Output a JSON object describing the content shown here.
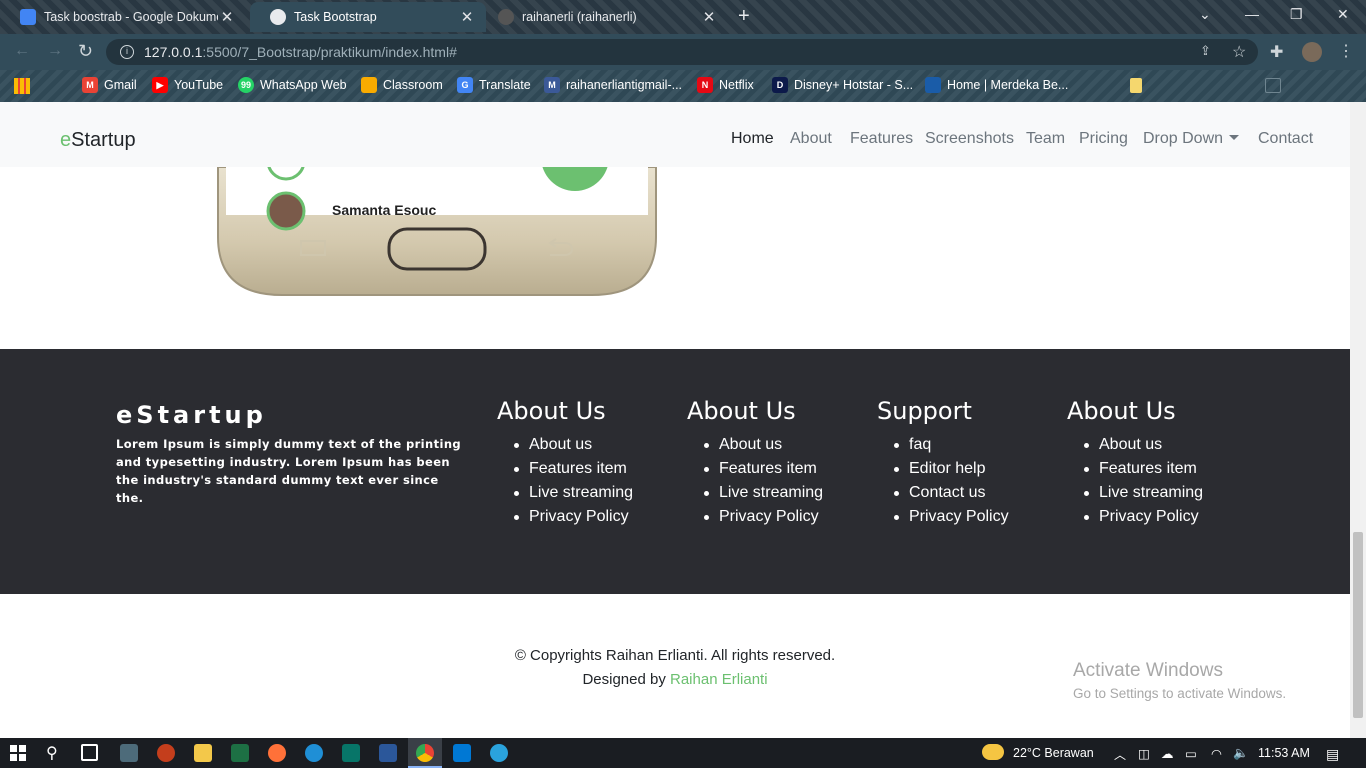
{
  "browser": {
    "tabs": [
      {
        "title": "Task boostrab - Google Dokumen",
        "icon": "google-docs-icon",
        "color": "#4285f4"
      },
      {
        "title": "Task Bootstrap",
        "icon": "globe-icon",
        "color": "#e8eaed"
      },
      {
        "title": "raihanerli (raihanerli)",
        "icon": "github-icon",
        "color": "#cccccc"
      }
    ],
    "url_host": "127.0.0.1",
    "url_path": ":5500/7_Bootstrap/praktikum/index.html#",
    "bookmarks": [
      {
        "label": "Gmail",
        "icon": "gmail-icon",
        "color": "#ea4335"
      },
      {
        "label": "YouTube",
        "icon": "youtube-icon",
        "color": "#ff0000"
      },
      {
        "label": "WhatsApp Web",
        "icon": "whatsapp-icon",
        "color": "#25d366"
      },
      {
        "label": "Classroom",
        "icon": "classroom-icon",
        "color": "#f9ab00"
      },
      {
        "label": "Translate",
        "icon": "translate-icon",
        "color": "#4285f4"
      },
      {
        "label": "raihanerliantigmail-...",
        "icon": "medium-icon",
        "color": "#3b5998"
      },
      {
        "label": "Netflix",
        "icon": "netflix-icon",
        "color": "#e50914"
      },
      {
        "label": "Disney+ Hotstar - S...",
        "icon": "hotstar-icon",
        "color": "#0c1a4a"
      },
      {
        "label": "Home | Merdeka Be...",
        "icon": "merdeka-icon",
        "color": "#1a5ca8"
      }
    ]
  },
  "site": {
    "brand_first": "e",
    "brand_rest": "Startup",
    "nav": [
      "Home",
      "About",
      "Features",
      "Screenshots",
      "Team",
      "Pricing",
      "Drop Down",
      "Contact"
    ],
    "phone_contact": "Samanta Esouc"
  },
  "footer": {
    "brand": "eStartup",
    "description": "Lorem Ipsum is simply dummy text of the printing and typesetting industry. Lorem Ipsum has been the industry's standard dummy text ever since the.",
    "columns": [
      {
        "title": "About Us",
        "items": [
          "About us",
          "Features item",
          "Live streaming",
          "Privacy Policy"
        ]
      },
      {
        "title": "About Us",
        "items": [
          "About us",
          "Features item",
          "Live streaming",
          "Privacy Policy"
        ]
      },
      {
        "title": "Support",
        "items": [
          "faq",
          "Editor help",
          "Contact us",
          "Privacy Policy"
        ]
      },
      {
        "title": "About Us",
        "items": [
          "About us",
          "Features item",
          "Live streaming",
          "Privacy Policy"
        ]
      }
    ],
    "copyright": "© Copyrights Raihan Erlianti. All rights reserved.",
    "designed_by_prefix": "Designed by",
    "designer": "Raihan Erlianti"
  },
  "watermark": {
    "line1": "Activate Windows",
    "line2": "Go to Settings to activate Windows."
  },
  "taskbar": {
    "weather": "22°C  Berawan",
    "time": "11:53 AM"
  },
  "colors": {
    "accent": "#6cc070",
    "footer_bg": "#2b2c31",
    "navbar_bg": "#f8f9fa"
  }
}
